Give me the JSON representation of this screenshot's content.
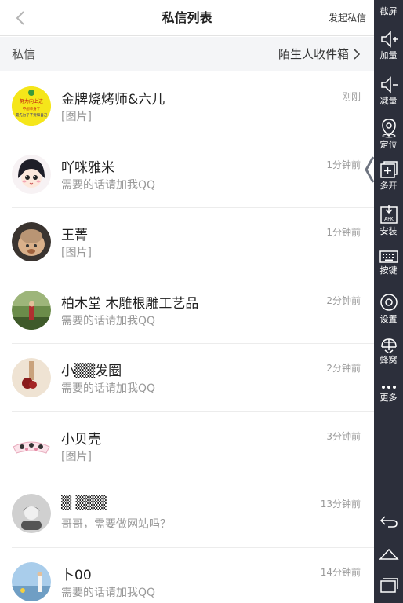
{
  "header": {
    "title": "私信列表",
    "action_label": "发起私信"
  },
  "subheader": {
    "left_label": "私信",
    "right_label": "陌生人收件箱"
  },
  "messages": [
    {
      "name": "金牌烧烤师&六儿",
      "preview": "[图片]",
      "time": "刚刚",
      "avatar_text": [
        "努力向上进",
        "不想单身了",
        "最先为了不要和自己"
      ],
      "avatar_color": "#f5e61a"
    },
    {
      "name": "吖咪雅米",
      "preview": "需要的话请加我QQ",
      "time": "1分钟前",
      "avatar_color": "#f7f2f4"
    },
    {
      "name": "王菁",
      "preview": "[图片]",
      "time": "1分钟前",
      "avatar_color": "#c8a27a"
    },
    {
      "name": "柏木堂 木雕根雕工艺品",
      "preview": "需要的话请加我QQ",
      "time": "2分钟前",
      "avatar_color": "#5a7a3a"
    },
    {
      "name": "小▒▒发圈",
      "preview": "需要的话请加我QQ",
      "time": "2分钟前",
      "avatar_color": "#e9dccb"
    },
    {
      "name": "小贝壳",
      "preview": "[图片]",
      "time": "3分钟前",
      "avatar_color": "#fbe9ee"
    },
    {
      "name": "▒ ▒▒▒",
      "preview": "哥哥，需要做网站吗？",
      "time": "13分钟前",
      "avatar_color": "#c9c9c9"
    },
    {
      "name": "卜00",
      "preview": "需要的话请加我QQ",
      "time": "14分钟前",
      "avatar_color": "#9fc3e6"
    }
  ],
  "toolbar": {
    "items": [
      {
        "label": "截屏",
        "icon": "screenshot-icon"
      },
      {
        "label": "加量",
        "icon": "volume-up-icon"
      },
      {
        "label": "减量",
        "icon": "volume-down-icon"
      },
      {
        "label": "定位",
        "icon": "location-icon"
      },
      {
        "label": "多开",
        "icon": "multi-open-icon"
      },
      {
        "label": "安装",
        "icon": "apk-install-icon"
      },
      {
        "label": "按键",
        "icon": "keyboard-icon"
      },
      {
        "label": "设置",
        "icon": "settings-icon"
      },
      {
        "label": "蜂窝",
        "icon": "honeycomb-icon"
      },
      {
        "label": "更多",
        "icon": "more-icon"
      }
    ],
    "nav": [
      "back-icon",
      "home-icon",
      "recent-apps-icon"
    ]
  }
}
